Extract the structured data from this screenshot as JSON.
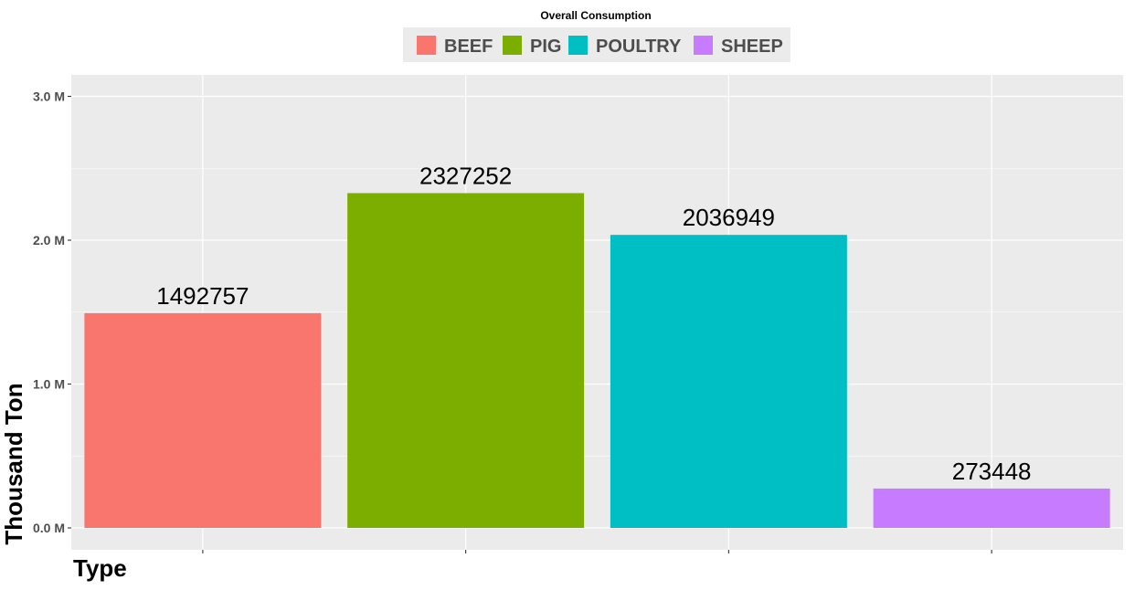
{
  "chart_data": {
    "type": "bar",
    "title": "Overall Consumption",
    "xlabel": "Type",
    "ylabel": "Thousand Ton",
    "categories": [
      "BEEF",
      "PIG",
      "POULTRY",
      "SHEEP"
    ],
    "values": [
      1492757,
      2327252,
      2036949,
      273448
    ],
    "colors": [
      "#F8766D",
      "#7CAE00",
      "#00BFC4",
      "#C77CFF"
    ],
    "ylim": [
      0,
      3150000
    ],
    "yticks": [
      0,
      1000000,
      2000000,
      3000000
    ],
    "ytick_labels": [
      "0.0 M",
      "1.0 M",
      "2.0 M",
      "3.0 M"
    ],
    "legend_position": "top",
    "grid": true,
    "panel_background": "#EBEBEB"
  }
}
